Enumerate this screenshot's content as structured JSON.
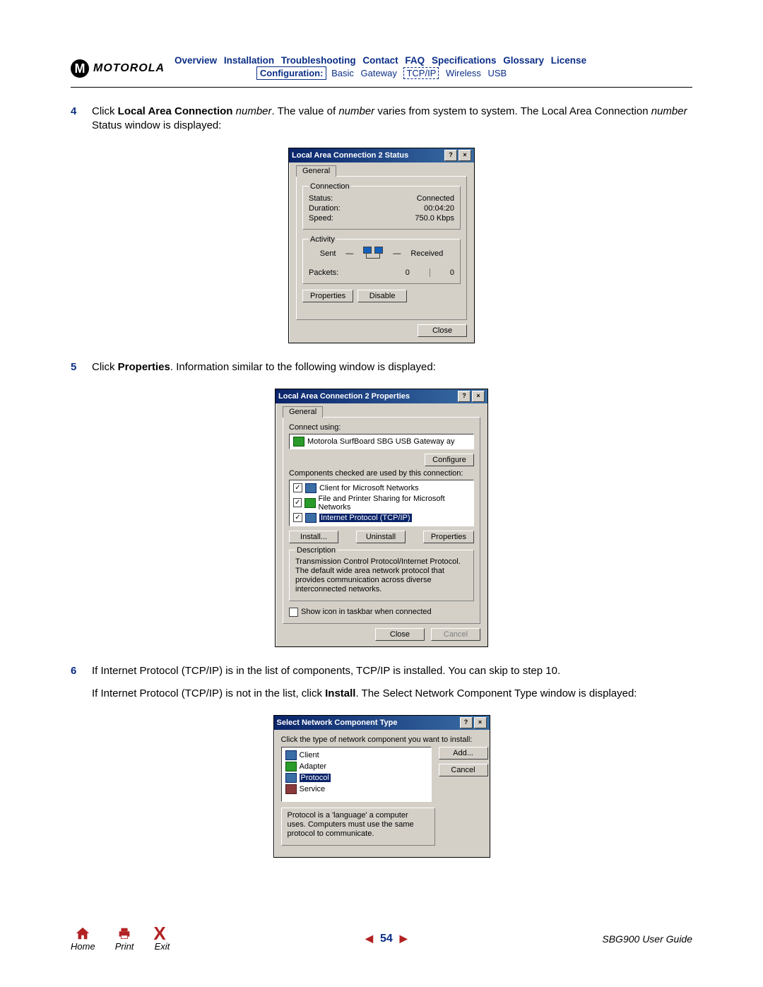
{
  "brand": "MOTOROLA",
  "nav": {
    "items": [
      "Overview",
      "Installation",
      "Troubleshooting",
      "Contact",
      "FAQ",
      "Specifications",
      "Glossary",
      "License"
    ],
    "config_label": "Configuration:",
    "sub_items": [
      "Basic",
      "Gateway",
      "TCP/IP",
      "Wireless",
      "USB"
    ]
  },
  "steps": {
    "s4": {
      "num": "4",
      "text_pre": "Click ",
      "bold1": "Local Area Connection",
      "italic1": " number",
      "text_mid": ". The value of ",
      "italic2": "number",
      "text_mid2": " varies from system to system. The Local Area Connection ",
      "italic3": "number",
      "text_end": " Status window is displayed:"
    },
    "s5": {
      "num": "5",
      "text_pre": "Click ",
      "bold1": "Properties",
      "text_end": ". Information similar to the following window is displayed:"
    },
    "s6": {
      "num": "6",
      "p1": "If Internet Protocol (TCP/IP) is in the list of components, TCP/IP is installed. You can skip to step 10.",
      "p2_pre": "If Internet Protocol (TCP/IP) is not in the list, click ",
      "p2_bold": "Install",
      "p2_end": ". The Select Network Component Type window is displayed:"
    }
  },
  "dlg_status": {
    "title": "Local Area Connection 2 Status",
    "tab": "General",
    "grp_conn": "Connection",
    "status_l": "Status:",
    "status_v": "Connected",
    "duration_l": "Duration:",
    "duration_v": "00:04:20",
    "speed_l": "Speed:",
    "speed_v": "750.0 Kbps",
    "grp_act": "Activity",
    "sent": "Sent",
    "received": "Received",
    "packets_l": "Packets:",
    "pk_sent": "0",
    "pk_recv": "0",
    "btn_props": "Properties",
    "btn_disable": "Disable",
    "btn_close": "Close"
  },
  "dlg_props": {
    "title": "Local Area Connection 2 Properties",
    "tab": "General",
    "connect_using": "Connect using:",
    "adapter": "Motorola SurfBoard SBG USB Gateway    ay",
    "btn_configure": "Configure",
    "components_label": "Components checked are used by this connection:",
    "items": [
      "Client for Microsoft Networks",
      "File and Printer Sharing for Microsoft Networks",
      "Internet Protocol (TCP/IP)"
    ],
    "btn_install": "Install...",
    "btn_uninstall": "Uninstall",
    "btn_properties": "Properties",
    "grp_desc": "Description",
    "desc": "Transmission Control Protocol/Internet Protocol. The default wide area network protocol that provides communication across diverse interconnected networks.",
    "show_icon": "Show icon in taskbar when connected",
    "btn_close": "Close",
    "btn_cancel": "Cancel"
  },
  "dlg_select": {
    "title": "Select Network Component Type",
    "instruction": "Click the type of network component you want to install:",
    "items": [
      "Client",
      "Adapter",
      "Protocol",
      "Service"
    ],
    "btn_add": "Add...",
    "btn_cancel": "Cancel",
    "desc": "Protocol is a 'language' a computer uses. Computers must use the same protocol to communicate."
  },
  "footer": {
    "home": "Home",
    "print": "Print",
    "exit": "Exit",
    "page": "54",
    "guide": "SBG900 User Guide"
  }
}
